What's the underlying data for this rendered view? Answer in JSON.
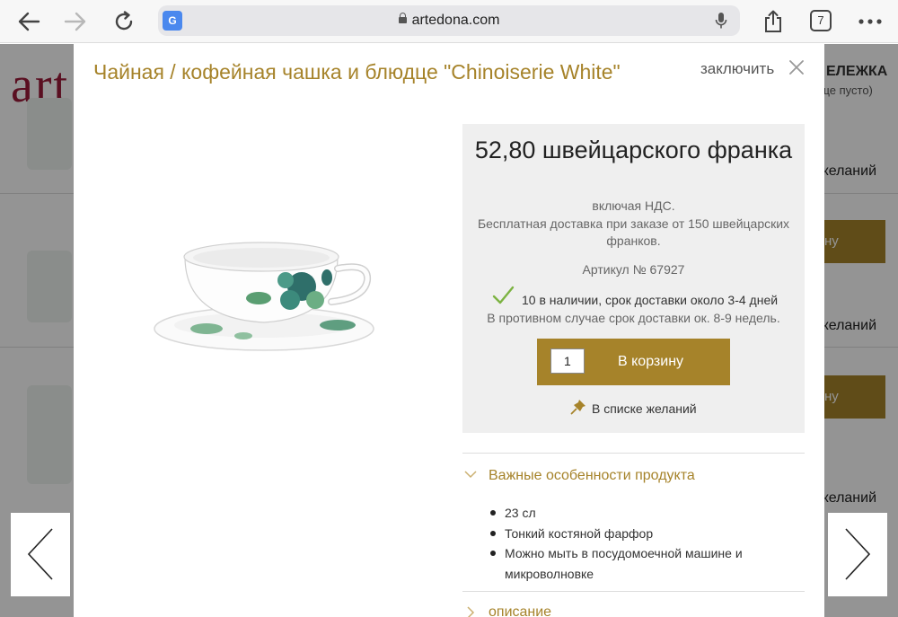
{
  "browser": {
    "url": "artedona.com",
    "tab_count": "7",
    "translate_glyph": "G"
  },
  "background_page": {
    "logo": "art",
    "cart_label": "ЕЛЕЖКА",
    "cart_status": "еще пусто)",
    "buttons": [
      "ну",
      "ну"
    ],
    "wishlist_links": [
      "желаний",
      "желаний",
      "желаний"
    ]
  },
  "modal": {
    "title": "Чайная / кофейная чашка и блюдце \"Chinoiserie White\"",
    "close_label": "заключить",
    "price": "52,80 швейцарского франка",
    "vat_note": "включая НДС.",
    "shipping_note": "Бесплатная доставка при заказе от 150 швейцарских франков.",
    "sku": "Артикул № 67927",
    "stock": "10 в наличии, срок доставки около 3-4 дней",
    "alt_delivery": "В противном случае срок доставки ок. 8-9 недель.",
    "quantity": "1",
    "add_to_cart": "В корзину",
    "wishlist": "В списке желаний",
    "features_title": "Важные особенности продукта",
    "features": [
      "23 сл",
      "Тонкий костяной фарфор",
      "Можно мыть в посудомоечной машине и микроволновке"
    ],
    "description_title": "описание"
  },
  "colors": {
    "accent": "#a6832a",
    "logo": "#9b1b3a",
    "check": "#7cb342"
  },
  "icons": {
    "back": "arrow-left-icon",
    "forward": "arrow-right-icon",
    "reload": "reload-icon",
    "mic": "microphone-icon",
    "share": "share-icon",
    "more": "more-dots-icon",
    "close": "close-x-icon",
    "check": "checkmark-icon",
    "pin": "pin-icon",
    "chevron": "chevron-icon"
  }
}
